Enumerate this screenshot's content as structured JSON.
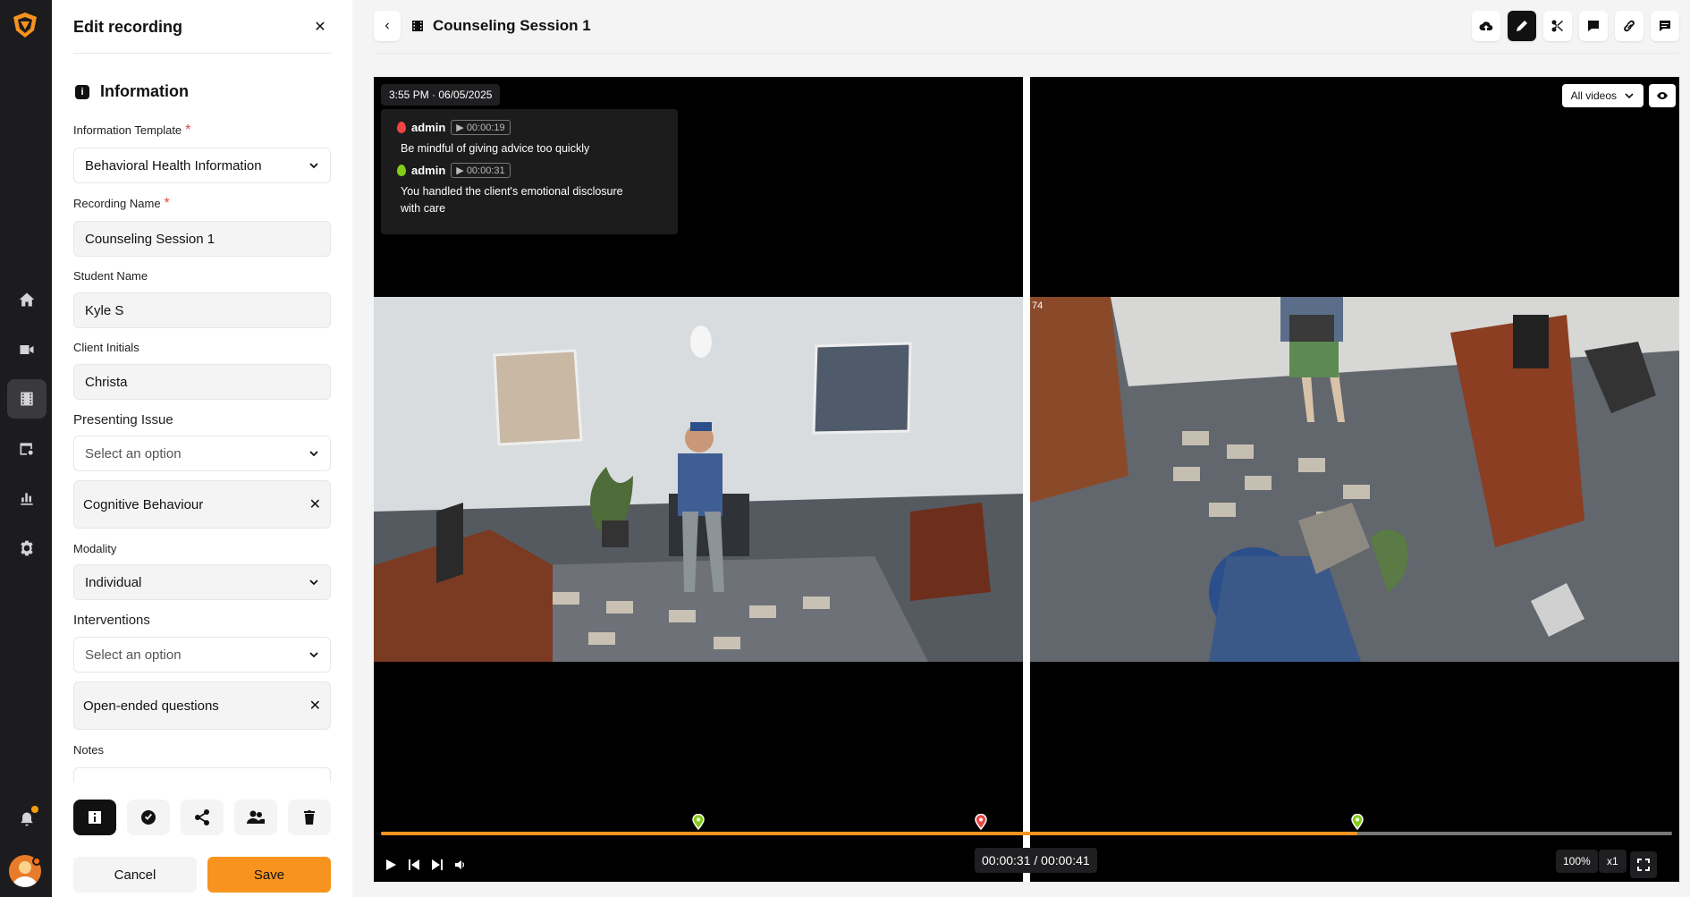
{
  "panel": {
    "title": "Edit recording",
    "section": "Information",
    "fields": {
      "template_label": "Information Template",
      "template_value": "Behavioral Health Information",
      "name_label": "Recording Name",
      "name_value": "Counseling Session 1",
      "student_label": "Student Name",
      "student_value": "Kyle S",
      "client_label": "Client Initials",
      "client_value": "Christa",
      "issue_label": "Presenting Issue",
      "issue_placeholder": "Select an option",
      "issue_chip": "Cognitive Behaviour",
      "modality_label": "Modality",
      "modality_value": "Individual",
      "interventions_label": "Interventions",
      "interventions_placeholder": "Select an option",
      "interventions_chip": "Open-ended questions",
      "notes_label": "Notes"
    },
    "required_mark": "*",
    "cancel": "Cancel",
    "save": "Save"
  },
  "header": {
    "title": "Counseling Session 1"
  },
  "player": {
    "timestamp": "3:55 PM · 06/05/2025",
    "comments": [
      {
        "user": "admin",
        "time": "▶ 00:00:19",
        "text": "Be mindful of giving advice too quickly",
        "color": "#ef4444"
      },
      {
        "user": "admin",
        "time": "▶ 00:00:31",
        "text": "You handled the client's emotional disclosure with care",
        "color": "#84cc16"
      }
    ],
    "video_select": "All videos",
    "cam2_label": "74",
    "timecode": "00:00:31 / 00:00:41",
    "progress_fraction": 0.756,
    "markers": [
      {
        "position_fraction": 0.246,
        "color": "#84cc16"
      },
      {
        "position_fraction": 0.465,
        "color": "#ef4444"
      },
      {
        "position_fraction": 0.756,
        "color": "#84cc16"
      }
    ],
    "zoom": "100%",
    "speed": "x1"
  },
  "colors": {
    "accent": "#f7931e",
    "rail_bg": "#1c1c1e"
  }
}
